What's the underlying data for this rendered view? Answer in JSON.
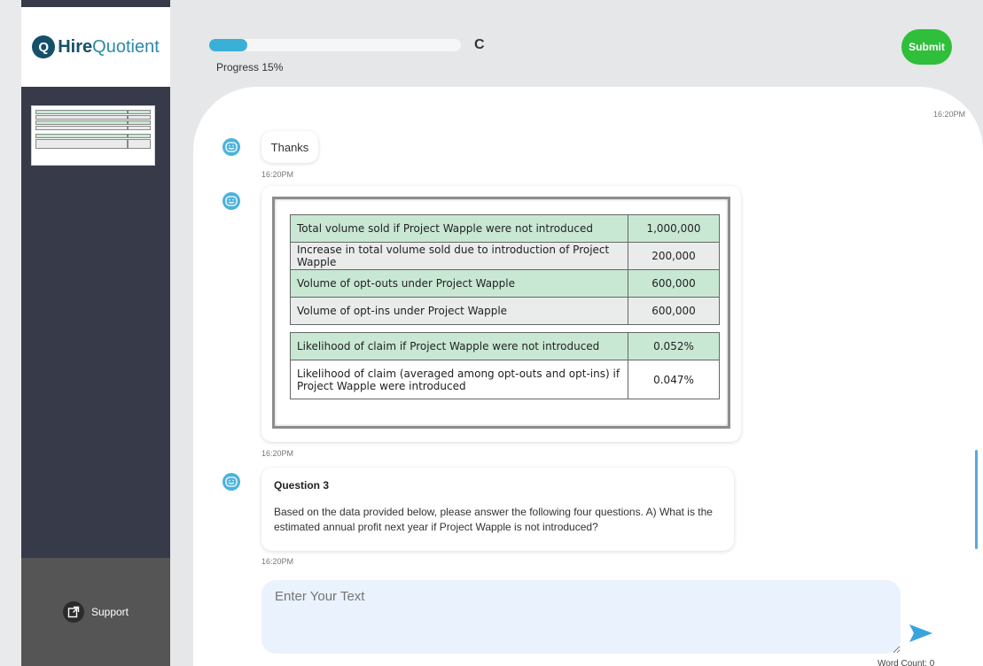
{
  "brand": {
    "mark": "Q",
    "hire": "Hire",
    "quotient": "Quotient"
  },
  "sidebar": {
    "support_label": "Support"
  },
  "header": {
    "progress_label": "Progress 15%",
    "progress_value": 0.15,
    "refresh_icon": "C",
    "submit_label": "Submit"
  },
  "chat": {
    "top_timestamp": "16:20PM",
    "messages": [
      {
        "text": "Thanks",
        "time": "16:20PM"
      },
      {
        "type": "table-image",
        "time": "16:20PM"
      },
      {
        "title": "Question 3",
        "body": "Based on the data provided below, please answer the following four questions. A) What is the estimated annual profit next year if Project Wapple is not introduced?",
        "time": "16:20PM"
      }
    ],
    "table": {
      "rows_top": [
        {
          "label": "Total volume sold if Project Wapple were not introduced",
          "value": "1,000,000"
        },
        {
          "label": "Increase in total volume sold due to introduction of Project Wapple",
          "value": "200,000"
        },
        {
          "label": "Volume of opt-outs under Project Wapple",
          "value": "600,000"
        },
        {
          "label": "Volume of opt-ins  under Project Wapple",
          "value": "600,000"
        }
      ],
      "rows_bottom": [
        {
          "label": "Likelihood of claim if Project Wapple were not introduced",
          "value": "0.052%"
        },
        {
          "label": "Likelihood of claim (averaged among opt-outs and opt-ins) if Project Wapple were introduced",
          "value": "0.047%"
        }
      ]
    }
  },
  "composer": {
    "placeholder": "Enter Your Text",
    "word_count": "Word Count: 0"
  },
  "icons": {
    "bot": "bot-avatar-icon",
    "send": "send-icon",
    "support": "external-link-icon",
    "refresh": "refresh-icon"
  },
  "colors": {
    "accent": "#3bb0d6",
    "submit": "#2fbf3b",
    "sidebar": "#373a48",
    "table_green": "#c9e8d4"
  }
}
